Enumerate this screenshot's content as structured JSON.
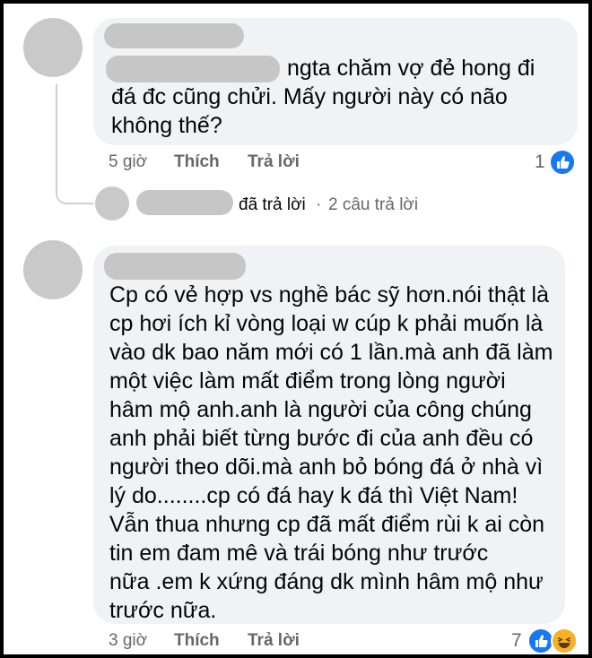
{
  "comments": [
    {
      "body": "ngta chăm vợ đẻ hong đi\nđá đc cũng chửi. Mấy người này có não\nkhông thế?",
      "time": "5 giờ",
      "like_label": "Thích",
      "reply_label": "Trả lời",
      "reaction_count": "1"
    },
    {
      "body": "Cp có vẻ hợp vs nghề bác sỹ hơn.nói thật là\ncp hơi ích kỉ vòng loại w cúp k phải muốn là\nvào dk bao năm mới có 1 lần.mà anh đã làm\nmột việc làm mất điểm trong lòng người\nhâm mộ anh.anh là người của công chúng\nanh phải biết từng bước đi của anh đều có\nngười theo dõi.mà anh bỏ bóng đá ở nhà vì\nlý do........cp có đá hay k đá thì Việt Nam!\nVẫn thua nhưng cp đã mất điểm rùi k ai còn\ntin em đam mê và trái bóng như trước\nnữa .em k xứng đáng dk mình hâm mộ như\ntrước nữa.",
      "time": "3 giờ",
      "like_label": "Thích",
      "reply_label": "Trả lời",
      "reaction_count": "7"
    }
  ],
  "reply_summary": {
    "replied_label": "đã trả lời",
    "separator": "·",
    "count_label": "2 câu trả lời"
  },
  "colors": {
    "bubble": "#f0f2f5",
    "meta": "#65676b",
    "like_blue": "#1877f2",
    "haha_yellow": "#f7b125",
    "redaction": "#c6c6c6"
  },
  "icons": [
    "like-icon",
    "haha-icon"
  ]
}
